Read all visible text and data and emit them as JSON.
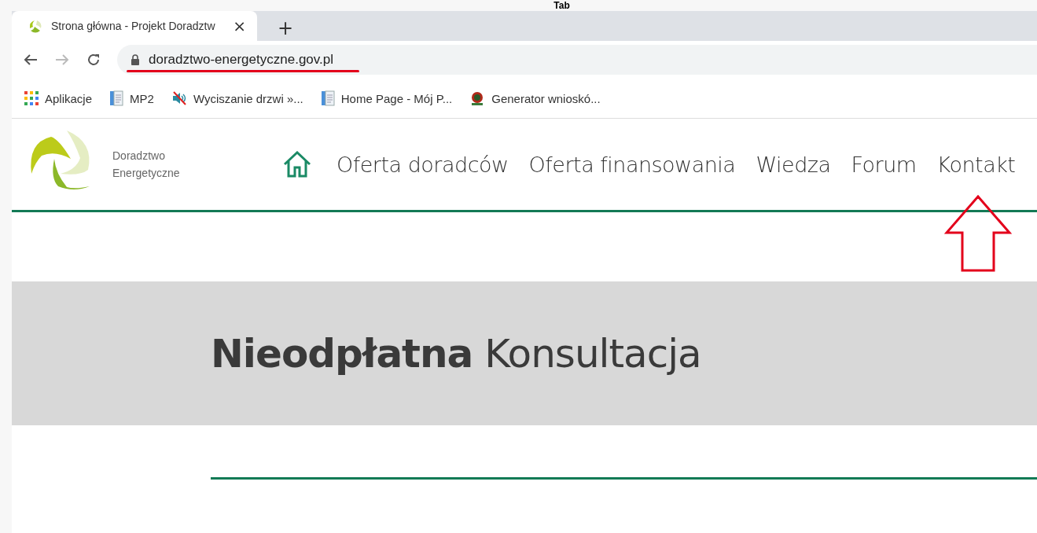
{
  "annotation": {
    "label": "Tab"
  },
  "browser": {
    "tabs": [
      {
        "title": "Strona główna - Projekt Doradztw",
        "close": "×",
        "selected": true
      }
    ],
    "new_tab": "+",
    "address": "doradztwo-energetyczne.gov.pl",
    "bookmarks": [
      {
        "kind": "apps",
        "label": "Aplikacje"
      },
      {
        "kind": "page",
        "label": "MP2"
      },
      {
        "kind": "mute",
        "label": "Wyciszanie drzwi »..."
      },
      {
        "kind": "page",
        "label": "Home Page - Mój P..."
      },
      {
        "kind": "seal",
        "label": "Generator wnioskó..."
      }
    ]
  },
  "site": {
    "logo_lines": [
      "Doradztwo",
      "Energetyczne"
    ],
    "nav": [
      {
        "kind": "home"
      },
      {
        "kind": "link",
        "label": "Oferta doradców"
      },
      {
        "kind": "link",
        "label": "Oferta finansowania"
      },
      {
        "kind": "link",
        "label": "Wiedza"
      },
      {
        "kind": "link",
        "label": "Forum"
      },
      {
        "kind": "link",
        "label": "Kontakt"
      }
    ],
    "banner_title": "**Nieodpłatna** Konsultacja"
  }
}
